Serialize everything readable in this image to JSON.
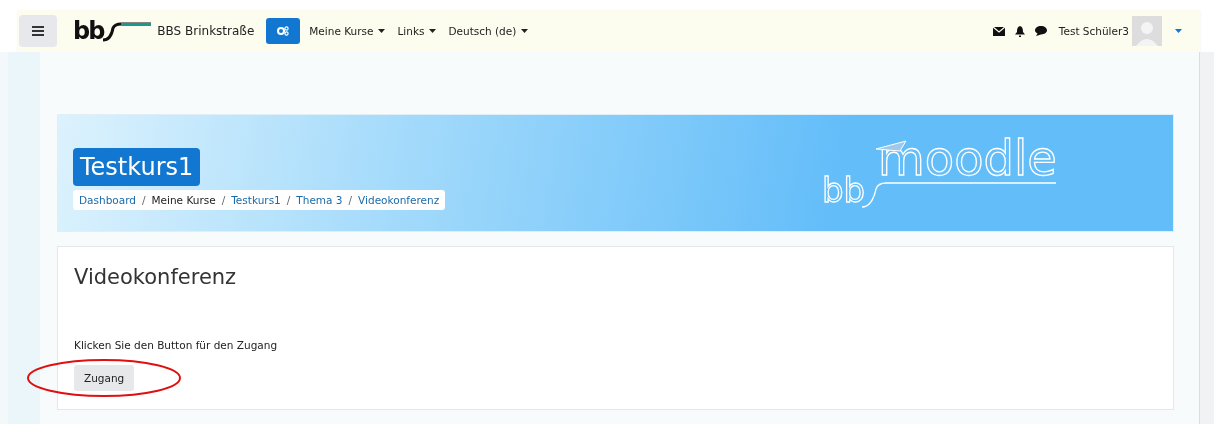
{
  "navbar": {
    "logo_text": "bb",
    "site_name": "BBS Brinkstraße",
    "menus": [
      {
        "label": "Meine Kurse"
      },
      {
        "label": "Links"
      },
      {
        "label": "Deutsch (de)"
      }
    ],
    "user": {
      "name": "Test Schüler3"
    }
  },
  "banner": {
    "course_title": "Testkurs1",
    "logo_prefix": "bb",
    "logo_name": "moodle",
    "breadcrumb_separator": "/",
    "breadcrumb": [
      {
        "label": "Dashboard",
        "link": true
      },
      {
        "label": "Meine Kurse",
        "link": false
      },
      {
        "label": "Testkurs1",
        "link": true
      },
      {
        "label": "Thema 3",
        "link": true
      },
      {
        "label": "Videokonferenz",
        "link": true
      }
    ]
  },
  "content": {
    "title": "Videokonferenz",
    "text": "Klicken Sie den Button für den Zugang",
    "button": "Zugang",
    "highlighted": true
  }
}
